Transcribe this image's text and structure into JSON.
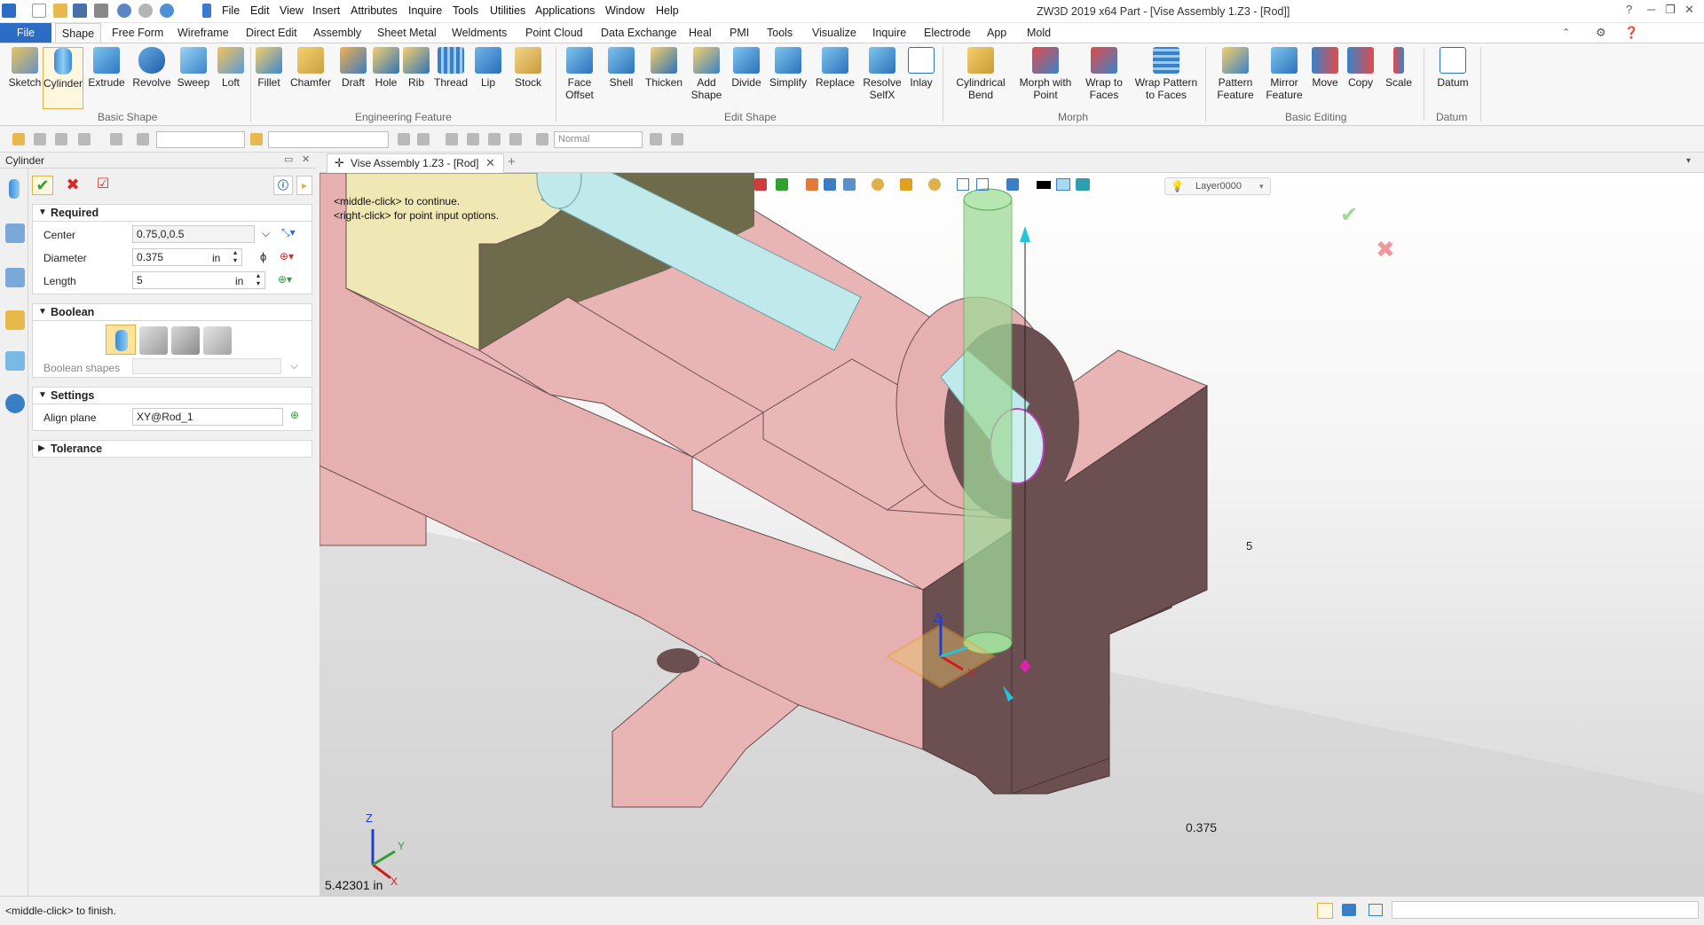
{
  "titlebar": {
    "menu": [
      "File",
      "Edit",
      "View",
      "Insert",
      "Attributes",
      "Inquire",
      "Tools",
      "Utilities",
      "Applications",
      "Window",
      "Help"
    ],
    "title": "ZW3D 2019  x64        Part - [Vise Assembly 1.Z3 - [Rod]]"
  },
  "ribbon_tabs": [
    "File",
    "Shape",
    "Free Form",
    "Wireframe",
    "Direct Edit",
    "Assembly",
    "Sheet Metal",
    "Weldments",
    "Point Cloud",
    "Data Exchange",
    "Heal",
    "PMI",
    "Tools",
    "Visualize",
    "Inquire",
    "Electrode",
    "App",
    "Mold"
  ],
  "ribbon": {
    "groups": [
      {
        "label": "Basic Shape",
        "buttons": [
          {
            "label": "Sketch",
            "icon": "sketch-icon"
          },
          {
            "label": "Cylinder",
            "icon": "cylinder-icon"
          },
          {
            "label": "Extrude",
            "icon": "extrude-icon"
          },
          {
            "label": "Revolve",
            "icon": "revolve-icon"
          },
          {
            "label": "Sweep",
            "icon": "sweep-icon"
          },
          {
            "label": "Loft",
            "icon": "loft-icon"
          }
        ]
      },
      {
        "label": "Engineering Feature",
        "buttons": [
          {
            "label": "Fillet",
            "icon": "fillet-icon"
          },
          {
            "label": "Chamfer",
            "icon": "chamfer-icon"
          },
          {
            "label": "Draft",
            "icon": "draft-icon"
          },
          {
            "label": "Hole",
            "icon": "hole-icon"
          },
          {
            "label": "Rib",
            "icon": "rib-icon"
          },
          {
            "label": "Thread",
            "icon": "thread-icon"
          },
          {
            "label": "Lip",
            "icon": "lip-icon"
          },
          {
            "label": "Stock",
            "icon": "stock-icon"
          }
        ]
      },
      {
        "label": "Edit Shape",
        "buttons": [
          {
            "label": "Face\nOffset",
            "icon": "face-offset-icon"
          },
          {
            "label": "Shell",
            "icon": "shell-icon"
          },
          {
            "label": "Thicken",
            "icon": "thicken-icon"
          },
          {
            "label": "Add\nShape",
            "icon": "add-shape-icon"
          },
          {
            "label": "Divide",
            "icon": "divide-icon"
          },
          {
            "label": "Simplify",
            "icon": "simplify-icon"
          },
          {
            "label": "Replace",
            "icon": "replace-icon"
          },
          {
            "label": "Resolve\nSelfX",
            "icon": "resolve-selfx-icon"
          },
          {
            "label": "Inlay",
            "icon": "inlay-icon"
          }
        ]
      },
      {
        "label": "Morph",
        "buttons": [
          {
            "label": "Cylindrical\nBend",
            "icon": "cylindrical-bend-icon"
          },
          {
            "label": "Morph with\nPoint",
            "icon": "morph-point-icon"
          },
          {
            "label": "Wrap to\nFaces",
            "icon": "wrap-faces-icon"
          },
          {
            "label": "Wrap Pattern\nto Faces",
            "icon": "wrap-pattern-icon"
          }
        ]
      },
      {
        "label": "Basic Editing",
        "buttons": [
          {
            "label": "Pattern\nFeature",
            "icon": "pattern-icon"
          },
          {
            "label": "Mirror\nFeature",
            "icon": "mirror-icon"
          },
          {
            "label": "Move",
            "icon": "move-icon"
          },
          {
            "label": "Copy",
            "icon": "copy-icon"
          },
          {
            "label": "Scale",
            "icon": "scale-icon"
          }
        ]
      },
      {
        "label": "Datum",
        "buttons": [
          {
            "label": "Datum",
            "icon": "datum-icon"
          }
        ]
      }
    ]
  },
  "toolbar2": {
    "render_mode": "Normal"
  },
  "panel": {
    "title": "Cylinder",
    "sections": {
      "required": "Required",
      "boolean": "Boolean",
      "settings": "Settings",
      "tolerance": "Tolerance"
    },
    "fields": {
      "center_label": "Center",
      "center_value": "0.75,0,0.5",
      "diameter_label": "Diameter",
      "diameter_value": "0.375",
      "diameter_unit": "in",
      "length_label": "Length",
      "length_value": "5",
      "length_unit": "in",
      "boolean_shapes_label": "Boolean shapes",
      "align_plane_label": "Align plane",
      "align_plane_value": "XY@Rod_1"
    }
  },
  "document_tab": "Vise Assembly 1.Z3 - [Rod]",
  "viewport": {
    "prompt_line1": "<middle-click> to continue.",
    "prompt_line2": "<right-click> for point input options.",
    "layer": "Layer0000",
    "readout": "5.42301 in",
    "dim_length": "5",
    "dim_diameter": "0.375",
    "triad": {
      "x": "X",
      "y": "Y",
      "z": "Z"
    }
  },
  "statusbar": {
    "text": "<middle-click> to finish."
  },
  "colors": {
    "part_pink": "#e9b4b4",
    "part_dark": "#6b4f51",
    "rod_cyan": "#bfe9ea",
    "preview_green": "#9fd99a",
    "accent_blue": "#2b6cc4"
  }
}
